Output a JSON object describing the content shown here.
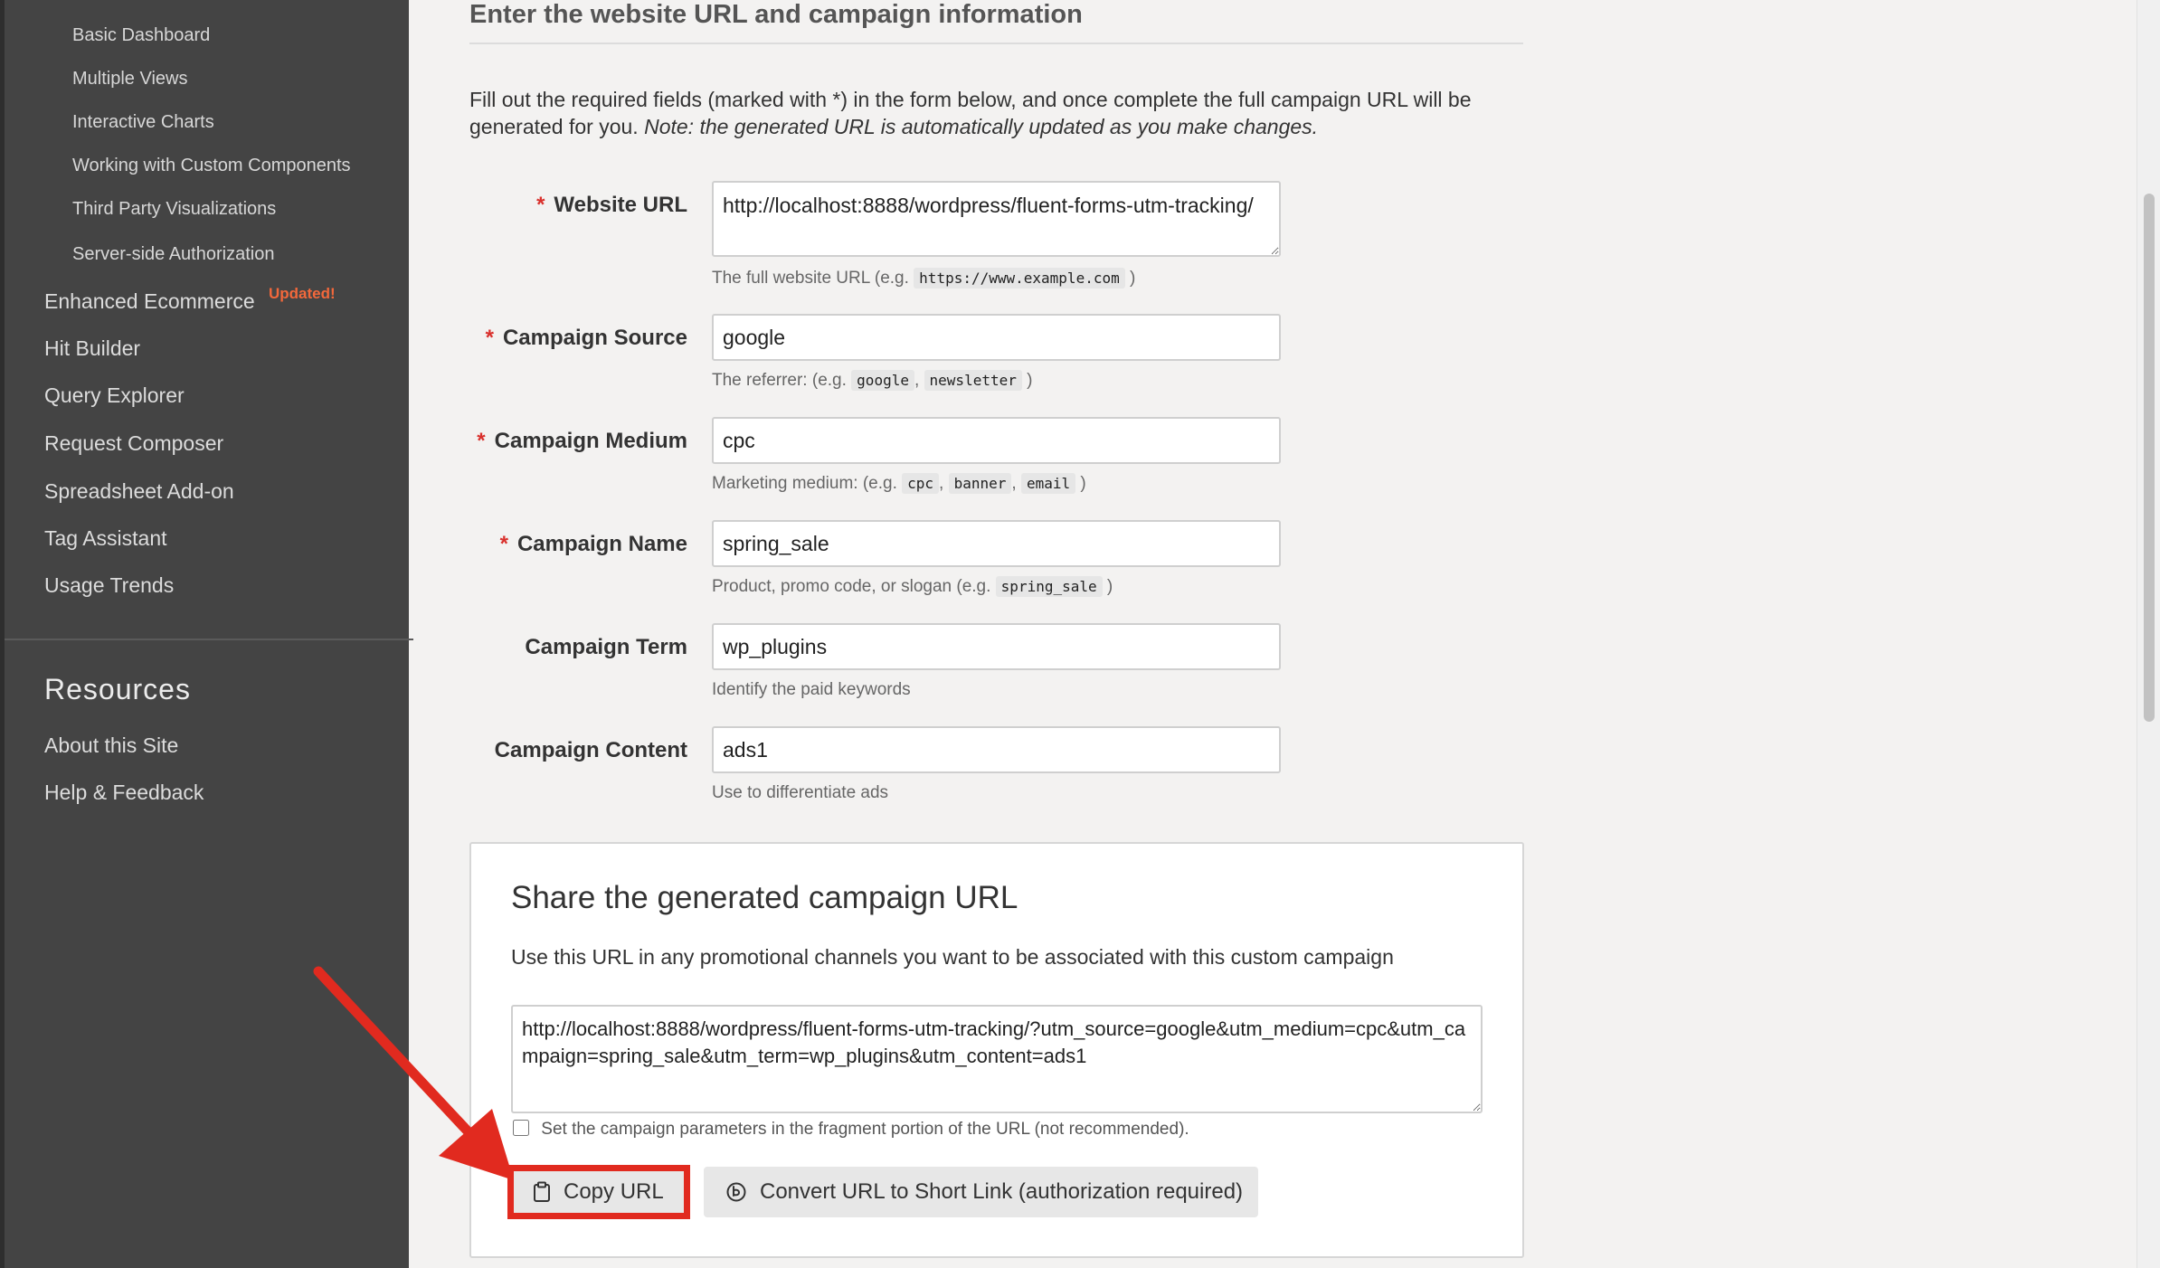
{
  "sidebar": {
    "sub_items": [
      {
        "label": "Basic Dashboard"
      },
      {
        "label": "Multiple Views"
      },
      {
        "label": "Interactive Charts"
      },
      {
        "label": "Working with Custom Components"
      },
      {
        "label": "Third Party Visualizations"
      },
      {
        "label": "Server-side Authorization"
      }
    ],
    "main_items": [
      {
        "label": "Enhanced Ecommerce",
        "badge": "Updated!"
      },
      {
        "label": "Hit Builder"
      },
      {
        "label": "Query Explorer"
      },
      {
        "label": "Request Composer"
      },
      {
        "label": "Spreadsheet Add-on"
      },
      {
        "label": "Tag Assistant"
      },
      {
        "label": "Usage Trends"
      }
    ],
    "resources_heading": "Resources",
    "resources_items": [
      {
        "label": "About this Site"
      },
      {
        "label": "Help & Feedback"
      }
    ]
  },
  "form": {
    "section_title": "Enter the website URL and campaign information",
    "intro": "Fill out the required fields (marked with *) in the form below, and once complete the full campaign URL will be generated for you.",
    "intro_note": "Note: the generated URL is automatically updated as you make changes.",
    "required_marker": "*",
    "fields": [
      {
        "label": "Website URL",
        "value": "http://localhost:8888/wordpress/fluent-forms-utm-tracking/",
        "help_prefix": "The full website URL (e.g.",
        "help_codes": [
          "https://www.example.com"
        ],
        "help_suffix": ")"
      },
      {
        "label": "Campaign Source",
        "value": "google",
        "help_prefix": "The referrer: (e.g.",
        "help_codes": [
          "google",
          "newsletter"
        ],
        "help_suffix": ")"
      },
      {
        "label": "Campaign Medium",
        "value": "cpc",
        "help_prefix": "Marketing medium: (e.g.",
        "help_codes": [
          "cpc",
          "banner",
          "email"
        ],
        "help_suffix": ")"
      },
      {
        "label": "Campaign Name",
        "value": "spring_sale",
        "help_prefix": "Product, promo code, or slogan (e.g.",
        "help_codes": [
          "spring_sale"
        ],
        "help_suffix": ")"
      },
      {
        "label": "Campaign Term",
        "value": "wp_plugins",
        "help_prefix": "Identify the paid keywords"
      },
      {
        "label": "Campaign Content",
        "value": "ads1",
        "help_prefix": "Use to differentiate ads"
      }
    ]
  },
  "share": {
    "title": "Share the generated campaign URL",
    "description": "Use this URL in any promotional channels you want to be associated with this custom campaign",
    "url": "http://localhost:8888/wordpress/fluent-forms-utm-tracking/?utm_source=google&utm_medium=cpc&utm_campaign=spring_sale&utm_term=wp_plugins&utm_content=ads1",
    "fragment_label": "Set the campaign parameters in the fragment portion of the URL (not recommended).",
    "copy_button": "Copy URL",
    "short_link_button": "Convert URL to Short Link (authorization required)",
    "copy_icon": "clipboard-icon",
    "short_link_icon": "link-icon"
  },
  "colors": {
    "sidebar_bg": "#444444",
    "badge": "#f2683b",
    "required": "#d9302c",
    "annotation": "#e12a1f"
  }
}
